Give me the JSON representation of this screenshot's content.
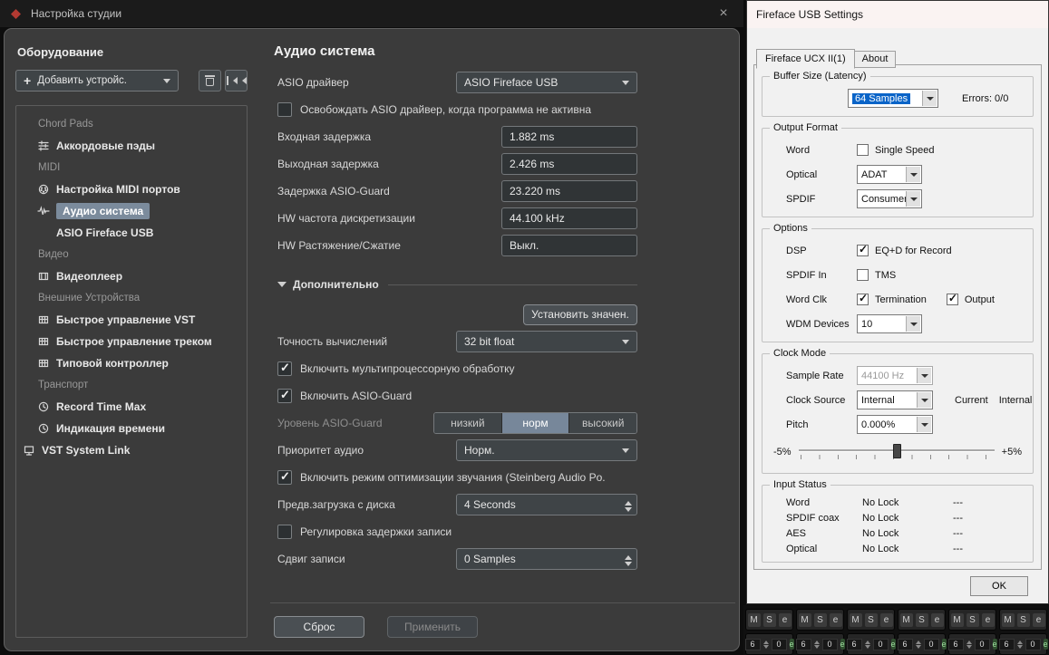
{
  "icons": {
    "close": "×"
  },
  "cubase": {
    "title": "Настройка студии",
    "sidebar": {
      "header": "Оборудование",
      "add_device_plus": "+",
      "add_device": "Добавить устройс.",
      "tree": [
        {
          "label": "Chord Pads"
        },
        {
          "label": "Аккордовые пэды"
        },
        {
          "label": "MIDI"
        },
        {
          "label": "Настройка MIDI портов"
        },
        {
          "label": "Аудио система",
          "selected": true
        },
        {
          "label": "ASIO Fireface USB"
        },
        {
          "label": "Видео"
        },
        {
          "label": "Видеоплеер"
        },
        {
          "label": "Внешние Устройства"
        },
        {
          "label": "Быстрое управление VST"
        },
        {
          "label": "Быстрое управление треком"
        },
        {
          "label": "Типовой контроллер"
        },
        {
          "label": "Транспорт"
        },
        {
          "label": "Record Time Max"
        },
        {
          "label": "Индикация времени"
        },
        {
          "label": "VST System Link"
        }
      ]
    },
    "main": {
      "title": "Аудио система",
      "asio_driver_label": "ASIO драйвер",
      "asio_driver_value": "ASIO Fireface USB",
      "release_label": "Освобождать ASIO драйвер, когда программа не активна",
      "release_checked": false,
      "latency_in_label": "Входная задержка",
      "latency_in_value": "1.882 ms",
      "latency_out_label": "Выходная задержка",
      "latency_out_value": "2.426 ms",
      "guard_latency_label": "Задержка ASIO-Guard",
      "guard_latency_value": "23.220 ms",
      "hw_rate_label": "HW частота дискретизации",
      "hw_rate_value": "44.100 kHz",
      "hw_pull_label": "HW Растяжение/Сжатие",
      "hw_pull_value": "Выкл.",
      "advanced_label": "Дополнительно",
      "set_defaults_label": "Установить значен.",
      "precision_label": "Точность вычислений",
      "precision_value": "32 bit float",
      "multicore_label": "Включить мультипроцессорную обработку",
      "multicore_checked": true,
      "guard_label": "Включить ASIO-Guard",
      "guard_checked": true,
      "guard_level_label": "Уровень ASIO-Guard",
      "guard_levels": [
        {
          "label": "низкий"
        },
        {
          "label": "норм",
          "selected": true
        },
        {
          "label": "высокий"
        }
      ],
      "priority_label": "Приоритет аудио",
      "priority_value": "Норм.",
      "power_label": "Включить режим оптимизации звучания (Steinberg Audio Po.",
      "power_checked": true,
      "preload_label": "Предв.загрузка с диска",
      "preload_value": "4 Seconds",
      "rec_adjust_label": "Регулировка задержки записи",
      "rec_adjust_checked": false,
      "rec_shift_label": "Сдвиг записи",
      "rec_shift_value": "0 Samples",
      "reset_label": "Сброс",
      "apply_label": "Применить"
    }
  },
  "fireface": {
    "title": "Fireface USB Settings",
    "tab_device": "Fireface UCX II(1)",
    "tab_about": "About",
    "buffer_group": "Buffer Size (Latency)",
    "buffer_value": "64 Samples",
    "errors": "Errors: 0/0",
    "output_group": "Output Format",
    "word_label": "Word",
    "single_speed_label": "Single Speed",
    "single_speed_checked": false,
    "optical_label": "Optical",
    "optical_value": "ADAT",
    "spdif_label": "SPDIF",
    "spdif_value": "Consumer",
    "options_group": "Options",
    "dsp_label": "DSP",
    "dsp_option": "EQ+D for Record",
    "dsp_checked": true,
    "spdif_in_label": "SPDIF In",
    "tms_label": "TMS",
    "tms_checked": false,
    "word_clk_label": "Word Clk",
    "termination_label": "Termination",
    "termination_checked": true,
    "output_label": "Output",
    "output_checked": true,
    "wdm_label": "WDM Devices",
    "wdm_value": "10",
    "clock_group": "Clock Mode",
    "sample_rate_label": "Sample Rate",
    "sample_rate_value": "44100 Hz",
    "clock_source_label": "Clock Source",
    "clock_source_value": "Internal",
    "current_label": "Current",
    "current_value": "Internal",
    "pitch_label": "Pitch",
    "pitch_value": "0.000%",
    "slider_min": "-5%",
    "slider_max": "+5%",
    "input_group": "Input Status",
    "input_rows": [
      {
        "label": "Word",
        "status": "No Lock",
        "detail": "---"
      },
      {
        "label": "SPDIF coax",
        "status": "No Lock",
        "detail": "---"
      },
      {
        "label": "AES",
        "status": "No Lock",
        "detail": "---"
      },
      {
        "label": "Optical",
        "status": "No Lock",
        "detail": "---"
      }
    ],
    "ok_label": "OK"
  },
  "mixer": {
    "mute": "M",
    "solo": "S",
    "edit": "e",
    "value_a": "6",
    "value_b": "0"
  }
}
